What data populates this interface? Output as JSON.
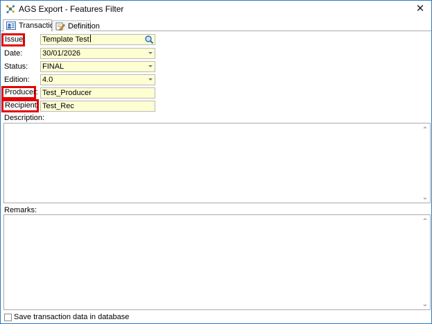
{
  "window": {
    "title": "AGS Export - Features Filter",
    "close_glyph": "✕"
  },
  "tabs": [
    {
      "label": "Transaction",
      "icon": "id-card-icon",
      "active": true
    },
    {
      "label": "Definition",
      "icon": "edit-document-icon",
      "active": false
    }
  ],
  "form": {
    "issue": {
      "label": "Issue:",
      "value": "Template Test"
    },
    "date": {
      "label": "Date:",
      "value": "30/01/2026"
    },
    "status": {
      "label": "Status:",
      "value": "FINAL"
    },
    "edition": {
      "label": "Edition:",
      "value": "4.0"
    },
    "producer": {
      "label": "Producer:",
      "value": "Test_Producer"
    },
    "recipient": {
      "label": "Recipient:",
      "value": "Test_Rec"
    }
  },
  "description": {
    "label": "Description:",
    "value": ""
  },
  "remarks": {
    "label": "Remarks:",
    "value": ""
  },
  "save_checkbox": {
    "label": "Save transaction data in database",
    "checked": false
  },
  "colors": {
    "field_bg": "#fefed3",
    "highlight_border": "#e60000",
    "window_border": "#2b78c5"
  }
}
